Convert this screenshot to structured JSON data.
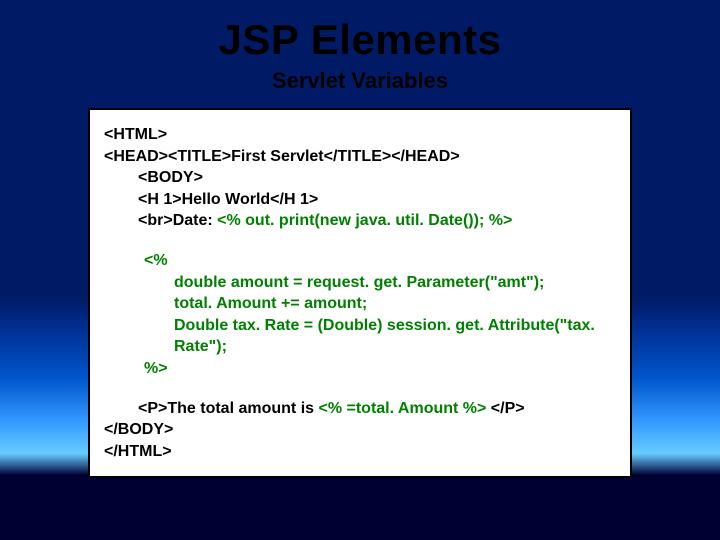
{
  "title": "JSP Elements",
  "subtitle": "Servlet Variables",
  "code": {
    "l1": "<HTML>",
    "l2": "<HEAD><TITLE>First Servlet</TITLE></HEAD>",
    "l3": "<BODY>",
    "l4": "<H 1>Hello World</H 1>",
    "l5a": "<br>Date: ",
    "l5b": "<% out. print(new java. util. Date()); %>",
    "l6": "<%",
    "l7": "double amount = request. get. Parameter(\"amt\");",
    "l8": "total. Amount += amount;",
    "l9": "Double tax. Rate = (Double) session. get. Attribute(\"tax. Rate\");",
    "l10": "%>",
    "l11a": "<P>The total amount is ",
    "l11b": "<% =total. Amount %>",
    "l11c": " </P>",
    "l12": "</BODY>",
    "l13": "</HTML>"
  }
}
